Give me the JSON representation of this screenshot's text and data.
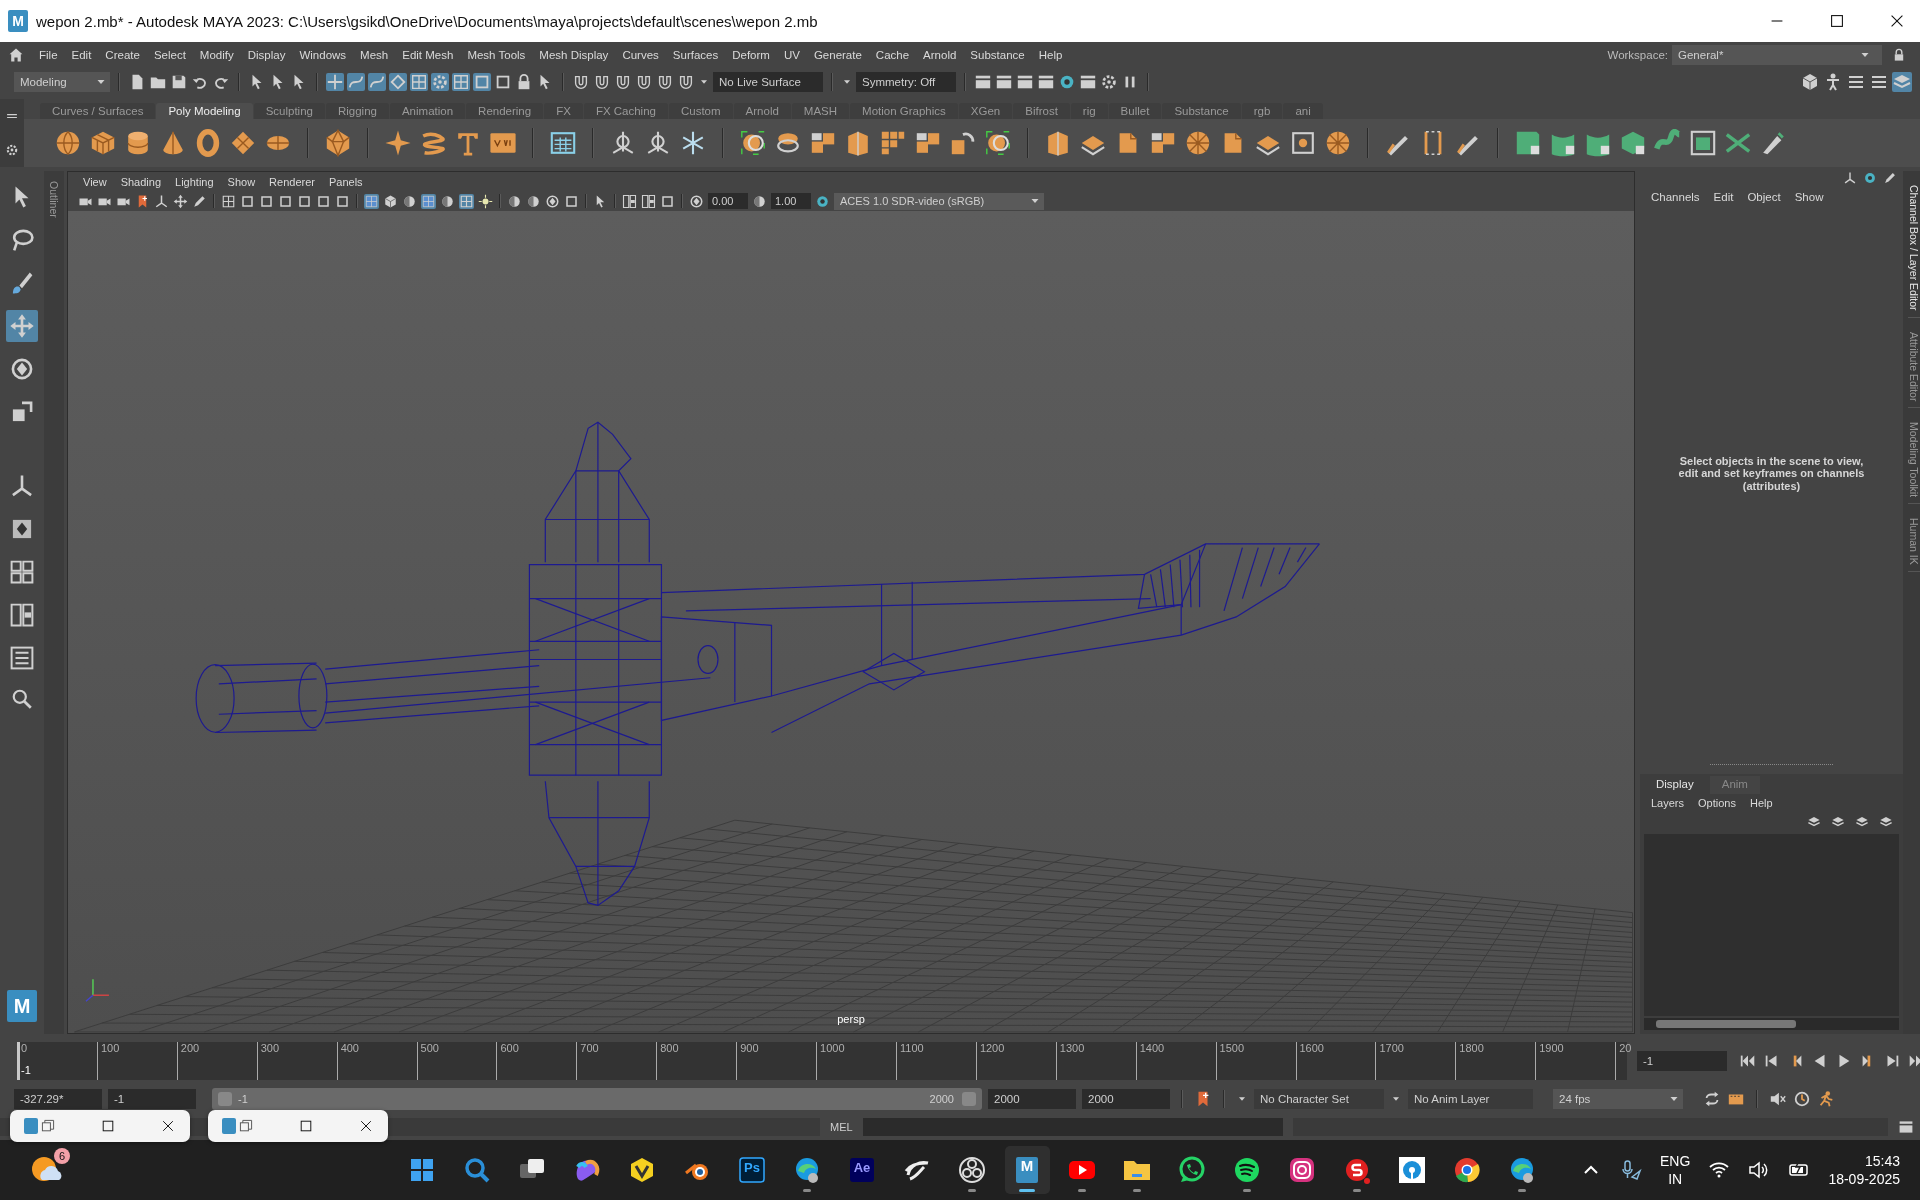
{
  "window": {
    "logo": "M",
    "title": "wepon 2.mb* - Autodesk MAYA 2023: C:\\Users\\gsikd\\OneDrive\\Documents\\maya\\projects\\default\\scenes\\wepon 2.mb"
  },
  "menu_bar": [
    "File",
    "Edit",
    "Create",
    "Select",
    "Modify",
    "Display",
    "Windows",
    "Mesh",
    "Edit Mesh",
    "Mesh Tools",
    "Mesh Display",
    "Curves",
    "Surfaces",
    "Deform",
    "UV",
    "Generate",
    "Cache",
    "Arnold",
    "Substance",
    "Help"
  ],
  "workspace": {
    "label": "Workspace:",
    "value": "General*"
  },
  "status_line": {
    "menu_set": "Modeling",
    "live_surface": "No Live Surface",
    "symmetry": "Symmetry: Off",
    "snap_toggles": [
      {
        "on": true
      },
      {
        "on": true
      },
      {
        "on": true
      },
      {
        "on": true
      },
      {
        "on": true
      },
      {
        "on": true
      },
      {
        "on": true
      },
      {
        "on": true
      }
    ]
  },
  "shelf_tabs": [
    {
      "label": "Curves / Surfaces",
      "selected": false
    },
    {
      "label": "Poly Modeling",
      "selected": true
    },
    {
      "label": "Sculpting",
      "selected": false
    },
    {
      "label": "Rigging",
      "selected": false
    },
    {
      "label": "Animation",
      "selected": false
    },
    {
      "label": "Rendering",
      "selected": false
    },
    {
      "label": "FX",
      "selected": false
    },
    {
      "label": "FX Caching",
      "selected": false
    },
    {
      "label": "Custom",
      "selected": false
    },
    {
      "label": "Arnold",
      "selected": false
    },
    {
      "label": "MASH",
      "selected": false
    },
    {
      "label": "Motion Graphics",
      "selected": false
    },
    {
      "label": "XGen",
      "selected": false
    },
    {
      "label": "Bifrost",
      "selected": false
    },
    {
      "label": "rig",
      "selected": false
    },
    {
      "label": "Bullet",
      "selected": false
    },
    {
      "label": "Substance",
      "selected": false
    },
    {
      "label": "rgb",
      "selected": false
    },
    {
      "label": "ani",
      "selected": false
    }
  ],
  "toolbox": {
    "logo": "M",
    "tools": [
      {
        "kind": "select",
        "selected": false
      },
      {
        "kind": "lasso",
        "selected": false
      },
      {
        "kind": "paint",
        "selected": false
      },
      {
        "kind": "move",
        "selected": true
      },
      {
        "kind": "rotate",
        "selected": false
      },
      {
        "kind": "scale",
        "selected": false
      }
    ]
  },
  "outliner_tab": "Outliner",
  "viewport": {
    "menu": [
      "View",
      "Shading",
      "Lighting",
      "Show",
      "Renderer",
      "Panels"
    ],
    "exposure": "0.00",
    "gamma": "1.00",
    "color_space": "ACES 1.0 SDR-video (sRGB)",
    "camera": "persp",
    "shading_toggles": [
      {
        "on": true
      },
      {
        "on": false
      },
      {
        "on": false
      },
      {
        "on": true
      },
      {
        "on": false
      },
      {
        "on": true
      },
      {
        "on": false
      }
    ]
  },
  "channel_box": {
    "menu": [
      "Channels",
      "Edit",
      "Object",
      "Show"
    ],
    "message": "Select objects in the scene to view, edit and set keyframes on channels (attributes)"
  },
  "side_tabs": [
    {
      "label": "Channel Box / Layer Editor",
      "selected": true
    },
    {
      "label": "Attribute Editor",
      "selected": false
    },
    {
      "label": "Modeling Toolkit",
      "selected": false
    },
    {
      "label": "Human IK",
      "selected": false
    }
  ],
  "layer_editor": {
    "tabs": [
      {
        "label": "Display",
        "selected": true
      },
      {
        "label": "Anim",
        "selected": false
      }
    ],
    "menu": [
      "Layers",
      "Options",
      "Help"
    ]
  },
  "time_slider": {
    "ticks": [
      "0",
      "100",
      "200",
      "300",
      "400",
      "500",
      "600",
      "700",
      "800",
      "900",
      "1000",
      "1100",
      "1200",
      "1300",
      "1400",
      "1500",
      "1600",
      "1700",
      "1800",
      "1900",
      "20"
    ],
    "current_frame": "-1",
    "frame_field": "-1",
    "level": 0
  },
  "range_slider": {
    "level": 1,
    "start_field": "-327.29*",
    "min_field": "-1",
    "range_start": "-1",
    "range_end": "2000",
    "end_field": "2000",
    "max_field": "2000",
    "character_set": "No Character Set",
    "anim_layer": "No Anim Layer",
    "fps": "24 fps"
  },
  "command_line": {
    "label": "MEL"
  },
  "taskbar": {
    "weather_badge": "6",
    "apps": [
      {
        "kind": "start",
        "running": false,
        "active": false
      },
      {
        "kind": "search",
        "running": false,
        "active": false
      },
      {
        "kind": "task-view",
        "running": false,
        "active": false
      },
      {
        "kind": "copilot",
        "running": false,
        "active": false
      },
      {
        "kind": "vector",
        "running": false,
        "active": false
      },
      {
        "kind": "blender",
        "running": false,
        "active": false
      },
      {
        "kind": "photoshop",
        "label": "Ps",
        "running": false,
        "active": false
      },
      {
        "kind": "edge-profile",
        "running": true,
        "active": false
      },
      {
        "kind": "after-effects",
        "label": "Ae",
        "running": false,
        "active": false
      },
      {
        "kind": "swirl",
        "running": false,
        "active": false
      },
      {
        "kind": "obs",
        "running": true,
        "active": false
      },
      {
        "kind": "maya",
        "label": "M",
        "running": true,
        "active": true
      },
      {
        "kind": "youtube",
        "running": true,
        "active": false
      },
      {
        "kind": "folder",
        "running": true,
        "active": false
      },
      {
        "kind": "whatsapp",
        "running": false,
        "active": false
      },
      {
        "kind": "spotify",
        "running": true,
        "active": false
      },
      {
        "kind": "instagram",
        "running": false,
        "active": false
      },
      {
        "kind": "substance",
        "running": true,
        "active": false
      },
      {
        "kind": "bank",
        "running": false,
        "active": false
      },
      {
        "kind": "chrome",
        "running": false,
        "active": false
      },
      {
        "kind": "edge-profile",
        "running": true,
        "active": false
      }
    ],
    "language": "ENG",
    "region": "IN",
    "time": "15:43",
    "date": "18-09-2025"
  }
}
